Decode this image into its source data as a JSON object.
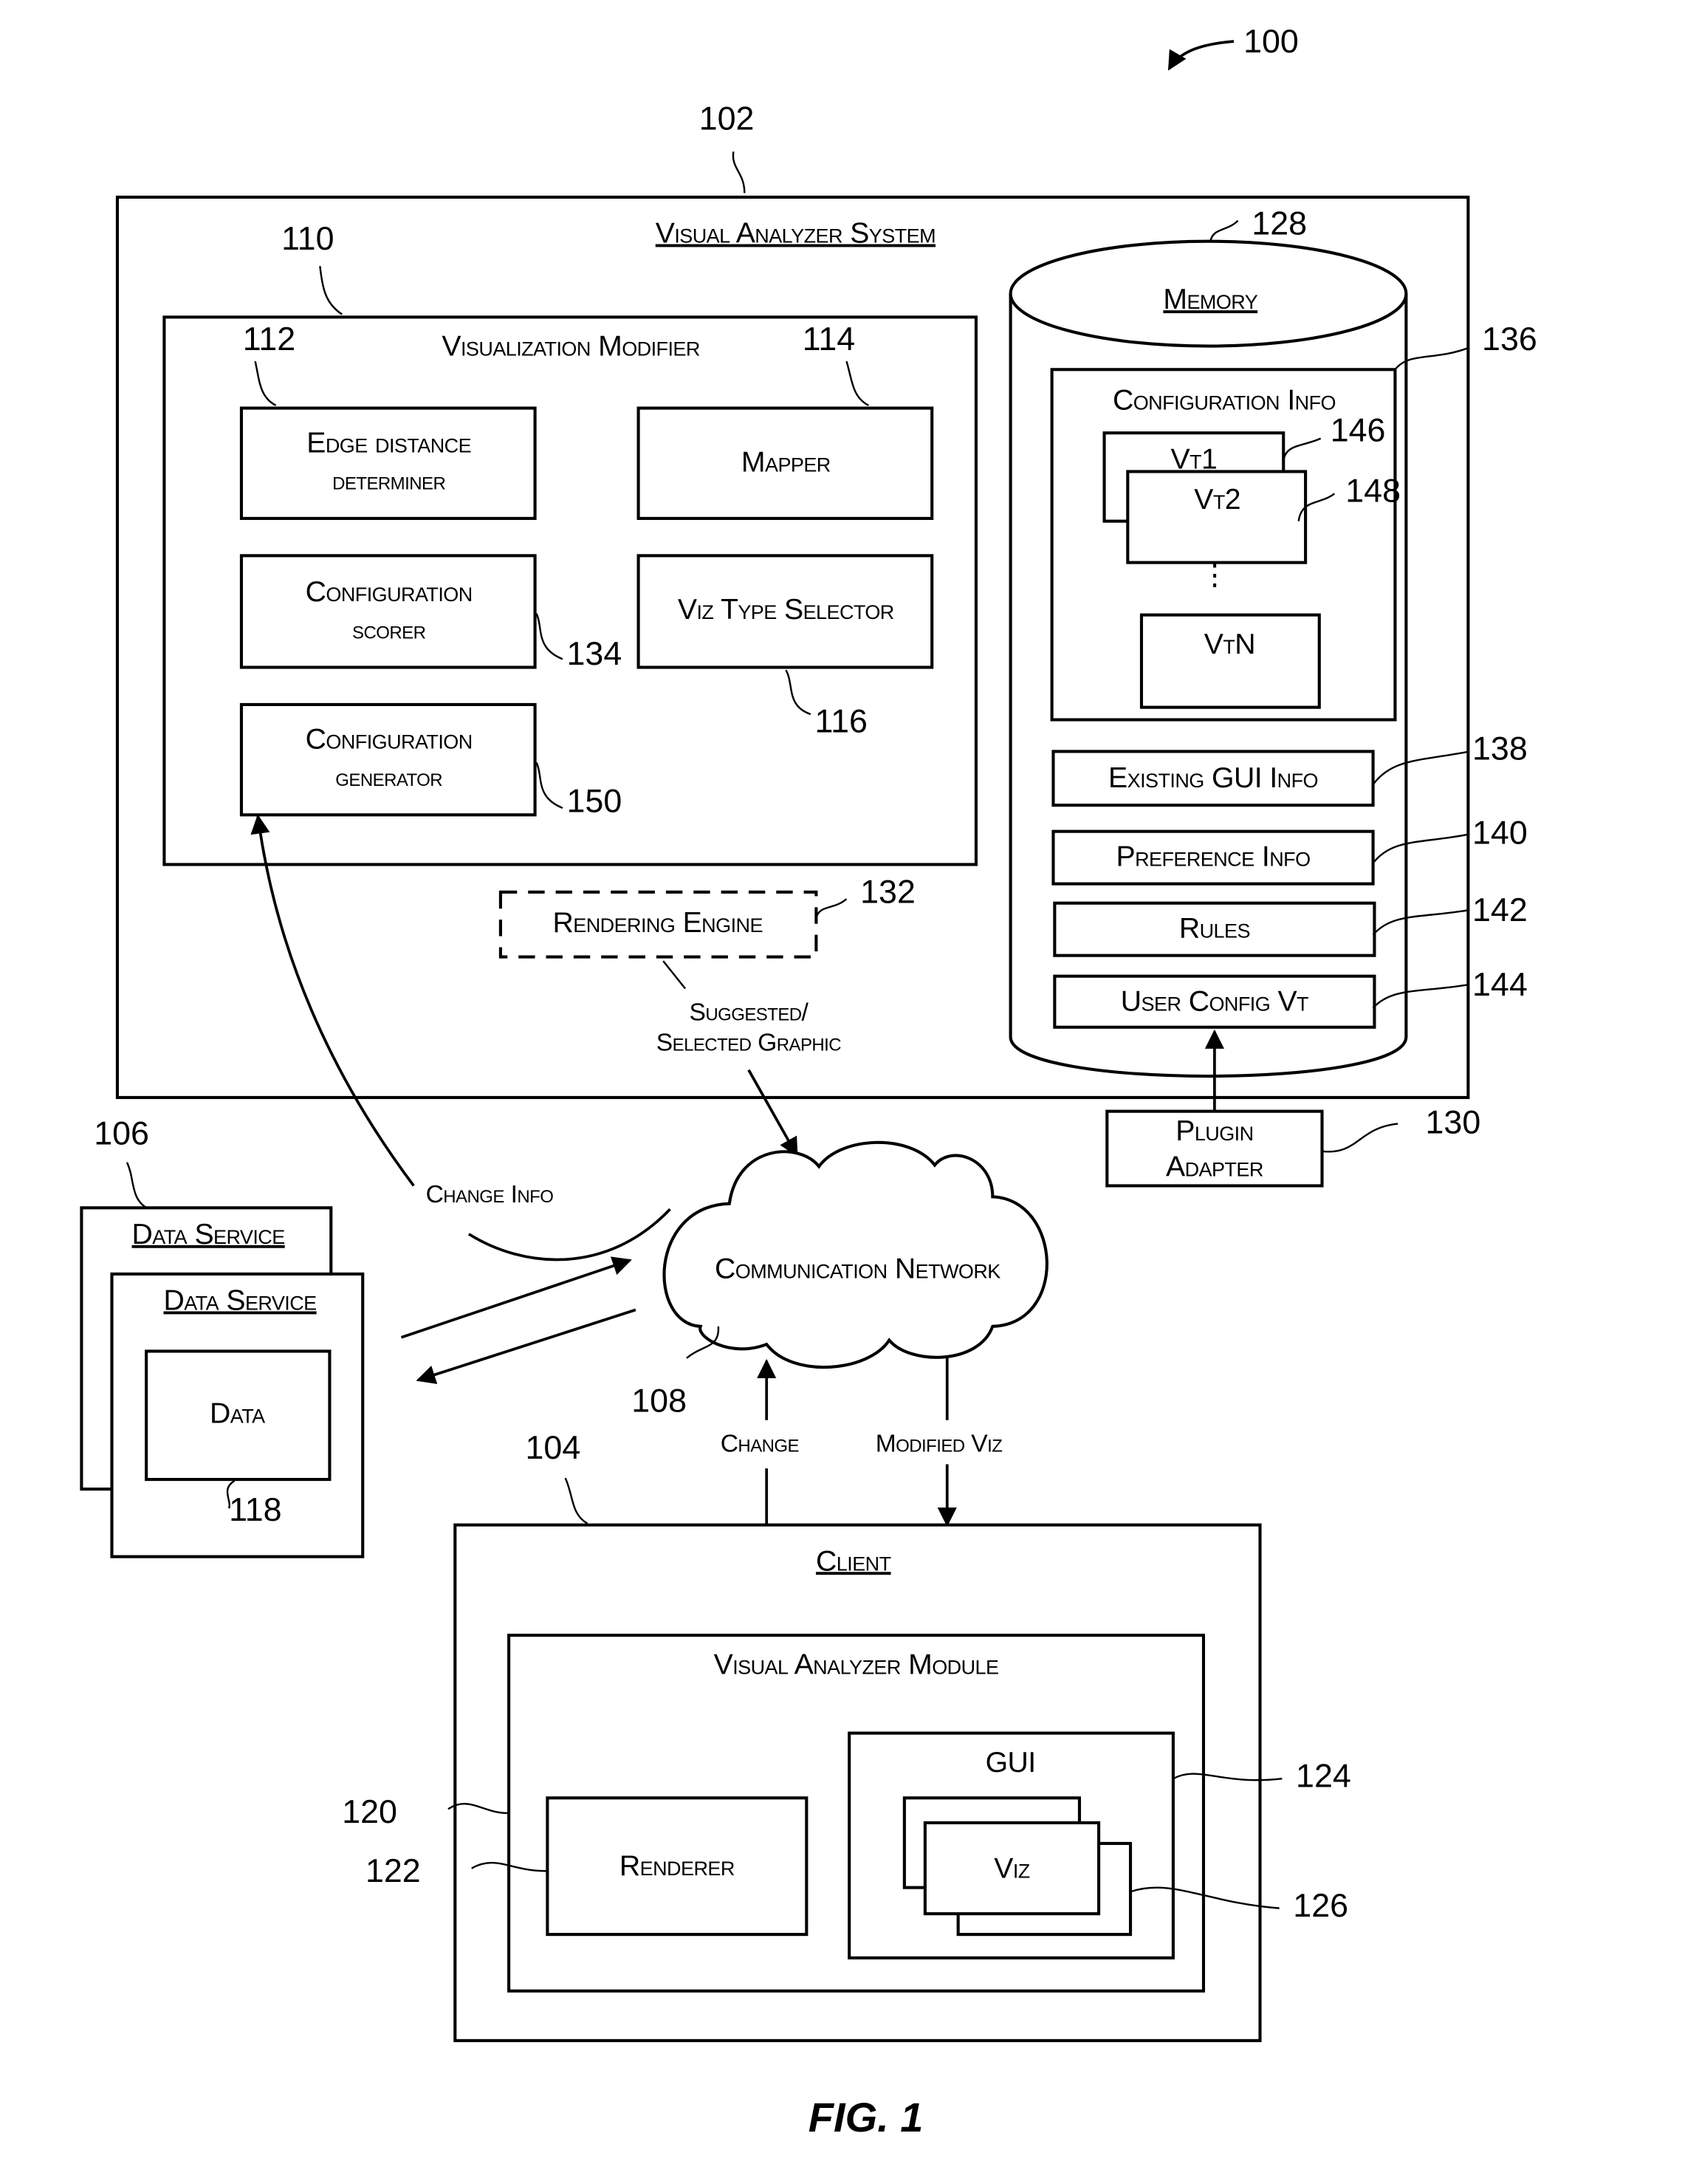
{
  "figure": {
    "caption": "FIG. 1",
    "ref": "100"
  },
  "system": {
    "title": "Visual Analyzer System",
    "ref": "102",
    "modifier": {
      "title": "Visualization Modifier",
      "ref": "110",
      "components": [
        {
          "id": "edge",
          "line1": "Edge distance",
          "line2": "determiner",
          "ref": "112"
        },
        {
          "id": "mapper",
          "line1": "Mapper",
          "line2": "",
          "ref": "114"
        },
        {
          "id": "scorer",
          "line1": "Configuration",
          "line2": "scorer",
          "ref": "134"
        },
        {
          "id": "viztype",
          "line1": "Viz Type Selector",
          "line2": "",
          "ref": "116"
        },
        {
          "id": "generator",
          "line1": "Configuration",
          "line2": "generator",
          "ref": "150"
        }
      ]
    },
    "rendering_engine": {
      "label": "Rendering Engine",
      "ref": "132"
    },
    "memory": {
      "title": "Memory",
      "ref": "128",
      "config_info": {
        "title": "Configuration Info",
        "ref": "136",
        "templates": [
          {
            "label": "Vt1",
            "ref": "146"
          },
          {
            "label": "Vt2",
            "ref": "148"
          },
          {
            "label": "VtN",
            "ref": ""
          }
        ],
        "ellipsis": "⋮"
      },
      "stores": [
        {
          "label": "Existing GUI Info",
          "ref": "138"
        },
        {
          "label": "Preference Info",
          "ref": "140"
        },
        {
          "label": "Rules",
          "ref": "142"
        },
        {
          "label": "User Config Vt",
          "ref": "144"
        }
      ]
    }
  },
  "plugin_adapter": {
    "line1": "Plugin",
    "line2": "Adapter",
    "ref": "130"
  },
  "data_service": {
    "title_back": "Data Service",
    "title_front": "Data Service",
    "data_label": "Data",
    "ref": "106",
    "data_ref": "118"
  },
  "network": {
    "label": "Communication Network",
    "ref": "108"
  },
  "flows": {
    "suggested_line1": "Suggested/",
    "suggested_line2": "Selected Graphic",
    "change_info": "Change Info",
    "change": "Change",
    "modified_viz": "Modified Viz"
  },
  "client": {
    "title": "Client",
    "ref": "104",
    "module": {
      "title": "Visual Analyzer Module",
      "ref": "120"
    },
    "renderer": {
      "label": "Renderer",
      "ref": "122"
    },
    "gui": {
      "label": "GUI",
      "ref": "124"
    },
    "viz": {
      "label": "Viz",
      "ref": "126"
    }
  }
}
